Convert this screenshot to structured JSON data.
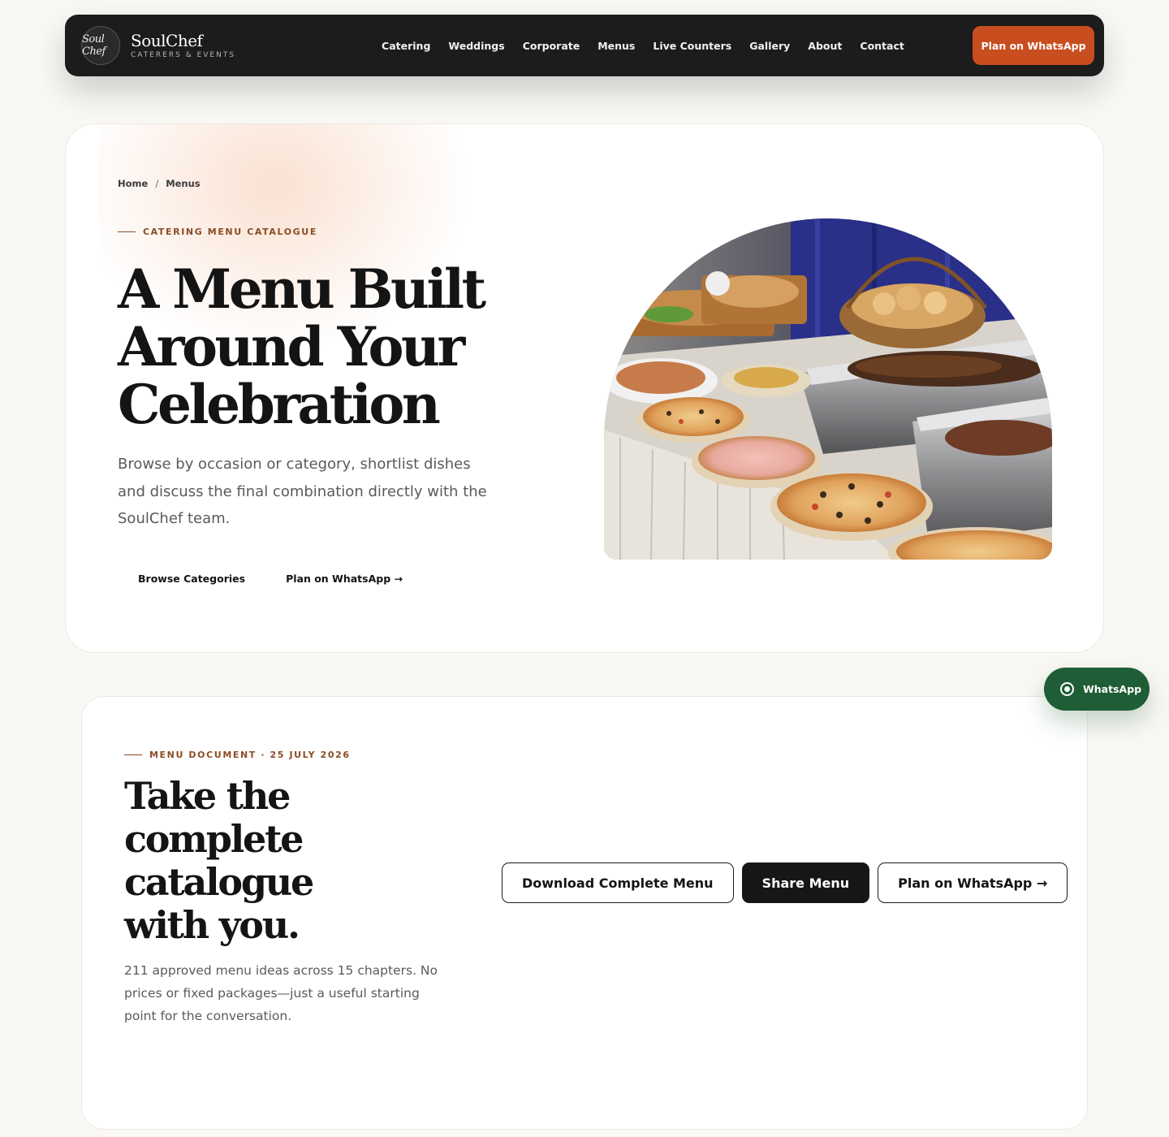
{
  "brand": {
    "logo_text": "Soul Chef",
    "name": "SoulChef",
    "tagline": "CATERERS & EVENTS"
  },
  "nav": {
    "links": [
      "Catering",
      "Weddings",
      "Corporate",
      "Menus",
      "Live Counters",
      "Gallery",
      "About",
      "Contact"
    ],
    "cta": "Plan on WhatsApp"
  },
  "hero": {
    "breadcrumb": [
      "Home",
      "Menus"
    ],
    "breadcrumb_sep": "/",
    "eyebrow": "CATERING MENU CATALOGUE",
    "title": "A Menu Built Around Your Celebration",
    "description": "Browse by occasion or category, shortlist dishes and discuss the final combination directly with the SoulChef team.",
    "actions": {
      "browse": "Browse Categories",
      "whatsapp": "Plan on WhatsApp →"
    }
  },
  "document": {
    "eyebrow": "MENU DOCUMENT · 25 JULY 2026",
    "title": "Take the complete catalogue with you.",
    "description": "211 approved menu ideas across 15 chapters. No prices or fixed packages—just a useful starting point for the conversation.",
    "actions": {
      "download": "Download Complete Menu",
      "share": "Share Menu",
      "whatsapp": "Plan on WhatsApp →"
    }
  },
  "floating_whatsapp": {
    "label": "WhatsApp"
  },
  "colors": {
    "accent": "#c84e1f",
    "dark": "#1c1c1c",
    "eyebrow": "#8a4c24",
    "whatsapp": "#1e5d35"
  }
}
